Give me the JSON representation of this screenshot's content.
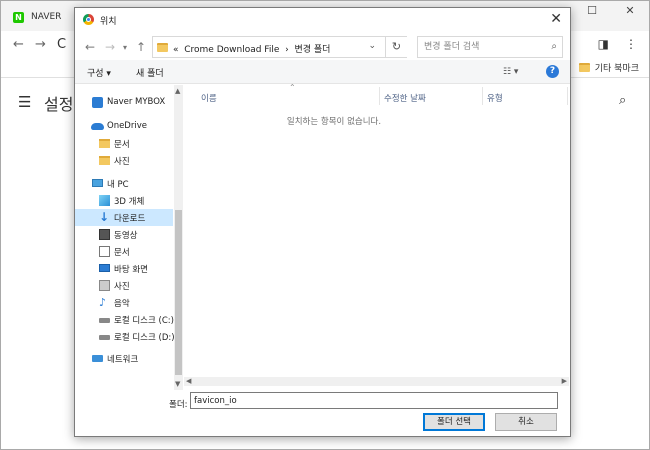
{
  "browser": {
    "tab_title": "NAVER",
    "favicon_letter": "N",
    "bookmark": "기타 북마크",
    "page_title": "설정"
  },
  "dialog": {
    "title": "위치",
    "address": {
      "prefix": "«",
      "segments": [
        "Crome Download File",
        "변경 폴더"
      ],
      "separator": "›"
    },
    "search_placeholder": "변경 폴더 검색",
    "commands": {
      "organize": "구성 ▾",
      "new_folder": "새 폴더"
    },
    "nav_items": [
      {
        "label": "Naver MYBOX",
        "icon": "naver-mybox-icon"
      },
      {
        "label": "OneDrive",
        "icon": "onedrive-cloud-icon"
      },
      {
        "label": "문서",
        "icon": "folder-icon"
      },
      {
        "label": "사진",
        "icon": "folder-icon"
      },
      {
        "label": "내 PC",
        "icon": "computer-icon"
      },
      {
        "label": "3D 개체",
        "icon": "3d-objects-icon"
      },
      {
        "label": "다운로드",
        "icon": "download-arrow-icon"
      },
      {
        "label": "동영상",
        "icon": "video-icon"
      },
      {
        "label": "문서",
        "icon": "document-icon"
      },
      {
        "label": "바탕 화면",
        "icon": "desktop-icon"
      },
      {
        "label": "사진",
        "icon": "pictures-icon"
      },
      {
        "label": "음악",
        "icon": "music-note-icon"
      },
      {
        "label": "로컬 디스크 (C:)",
        "icon": "drive-icon"
      },
      {
        "label": "로컬 디스크 (D:)",
        "icon": "drive-icon"
      },
      {
        "label": "네트워크",
        "icon": "network-icon"
      }
    ],
    "columns": [
      "이름",
      "수정한 날짜",
      "유형"
    ],
    "empty_message": "일치하는 항목이 없습니다.",
    "folder_label": "폴더:",
    "folder_value": "favicon_io",
    "select_button": "폴더 선택",
    "cancel_button": "취소"
  }
}
